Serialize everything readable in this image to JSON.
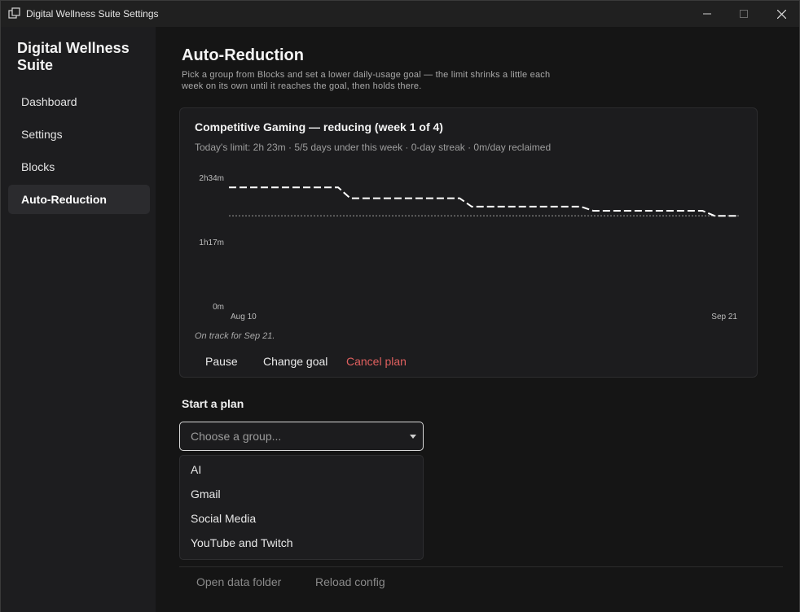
{
  "window": {
    "title": "Digital Wellness Suite Settings"
  },
  "sidebar": {
    "brand": "Digital Wellness Suite",
    "items": [
      {
        "label": "Dashboard"
      },
      {
        "label": "Settings"
      },
      {
        "label": "Blocks"
      },
      {
        "label": "Auto-Reduction",
        "active": true
      }
    ]
  },
  "page": {
    "title": "Auto-Reduction",
    "description": "Pick a group from Blocks and set a lower daily-usage goal — the limit shrinks a little each week on its own until it reaches the goal, then holds there."
  },
  "plan_card": {
    "title": "Competitive Gaming — reducing (week 1 of 4)",
    "subtitle": "Today's limit: 2h 23m · 5/5 days under this week · 0-day streak · 0m/day reclaimed",
    "status": "On track for Sep 21.",
    "actions": {
      "pause": "Pause",
      "change_goal": "Change goal",
      "cancel": "Cancel plan"
    }
  },
  "chart_data": {
    "type": "line",
    "x_labels": [
      "Aug 10",
      "Sep 21"
    ],
    "y_tick_labels": [
      "0m",
      "1h17m",
      "2h34m"
    ],
    "ylim": [
      0,
      154
    ],
    "goal_minutes": 109,
    "series": [
      {
        "style": "dashed",
        "x": [
          "Aug 10",
          "Aug 19",
          "Aug 20",
          "Aug 29",
          "Aug 30",
          "Sep 8",
          "Sep 9",
          "Sep 18",
          "Sep 19",
          "Sep 21"
        ],
        "y": [
          143,
          143,
          130,
          130,
          120,
          120,
          115,
          115,
          109,
          109
        ]
      }
    ],
    "colors": {
      "line": "#ffffff",
      "goal": "#9a9a9a"
    }
  },
  "start_plan": {
    "title": "Start a plan",
    "select_placeholder": "Choose a group...",
    "options": [
      "AI",
      "Gmail",
      "Social Media",
      "YouTube and Twitch"
    ]
  },
  "footer": {
    "open_data": "Open data folder",
    "reload": "Reload config"
  }
}
